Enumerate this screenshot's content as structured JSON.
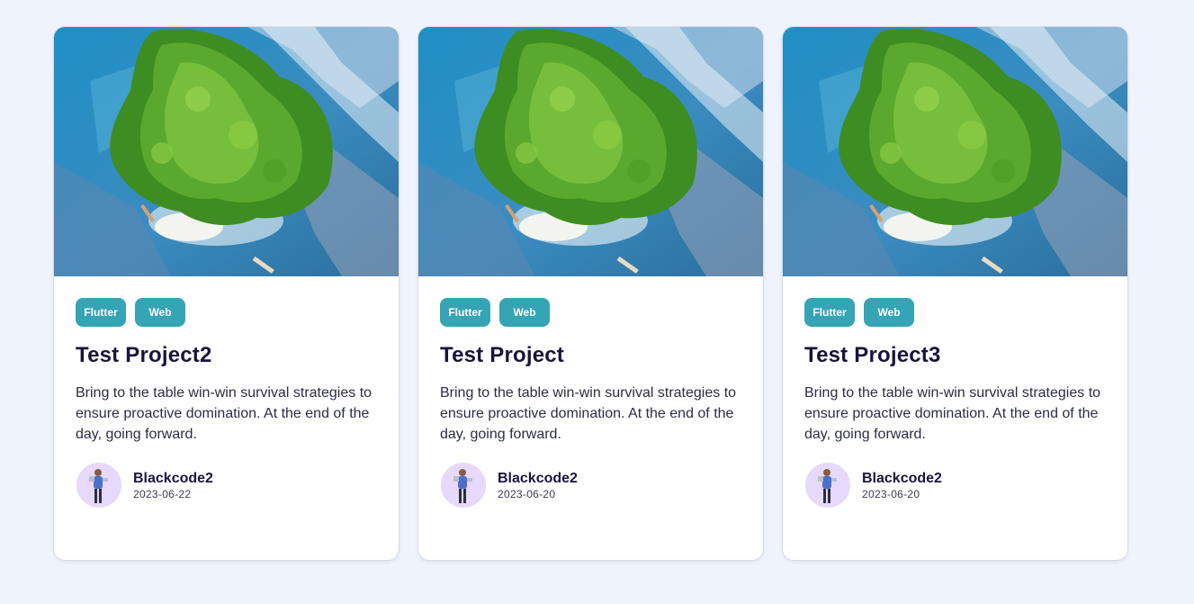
{
  "colors": {
    "page_background": "#eff3fd",
    "card_background": "#ffffff",
    "tag_background": "#35a4b5",
    "tag_text": "#ffffff",
    "title_text": "#17153a",
    "avatar_background": "#e7d9fb"
  },
  "cards": [
    {
      "image_icon": "island-aerial-photo",
      "tags": [
        "Flutter",
        "Web"
      ],
      "title": "Test Project2",
      "description": "Bring to the table win-win survival strategies to ensure proactive domination. At the end of the day, going forward.",
      "author": {
        "name": "Blackcode2",
        "date": "2023-06-22",
        "avatar_icon": "person-avatar"
      }
    },
    {
      "image_icon": "island-aerial-photo",
      "tags": [
        "Flutter",
        "Web"
      ],
      "title": "Test Project",
      "description": "Bring to the table win-win survival strategies to ensure proactive domination. At the end of the day, going forward.",
      "author": {
        "name": "Blackcode2",
        "date": "2023-06-20",
        "avatar_icon": "person-avatar"
      }
    },
    {
      "image_icon": "island-aerial-photo",
      "tags": [
        "Flutter",
        "Web"
      ],
      "title": "Test Project3",
      "description": "Bring to the table win-win survival strategies to ensure proactive domination. At the end of the day, going forward.",
      "author": {
        "name": "Blackcode2",
        "date": "2023-06-20",
        "avatar_icon": "person-avatar"
      }
    }
  ]
}
